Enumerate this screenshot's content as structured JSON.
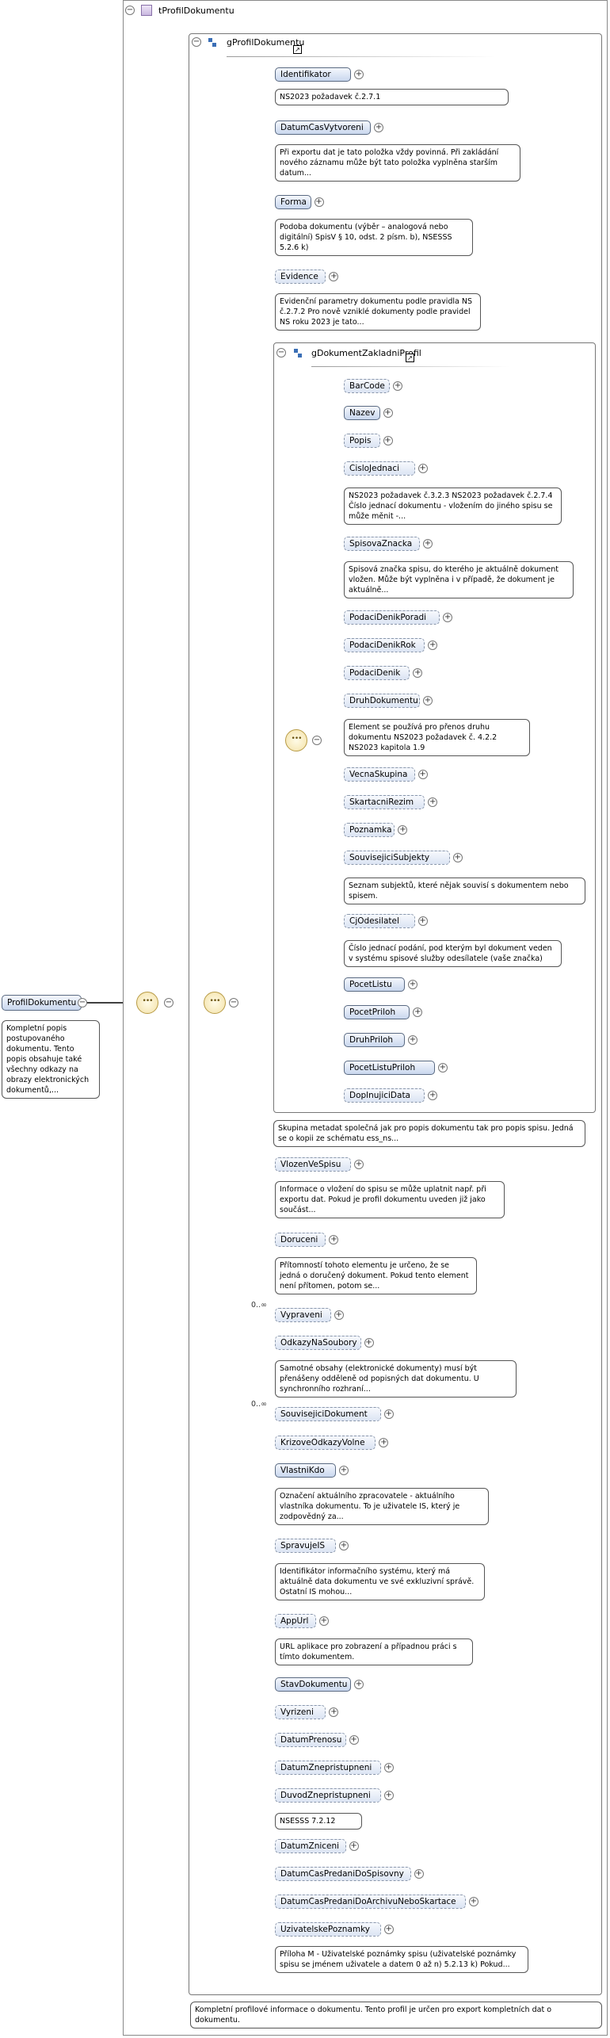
{
  "root": {
    "name": "ProfilDokumentu",
    "annotation": "Kompletní popis postupovaného dokumentu.  Tento popis obsahuje také všechny odkazy na obrazy elektronických dokumentů,..."
  },
  "complex_type": {
    "name": "tProfilDokumentu",
    "annotation": "Kompletní profilové informace o dokumentu. Tento profil je určen pro export kompletních dat o dokumentu."
  },
  "group_profil": {
    "name": "gProfilDokumentu",
    "annotation": "Skupina metadat společná jak pro popis dokumentu tak pro popis spisu. Jedná se o kopii ze schématu ess_ns..."
  },
  "group_zakladni": {
    "name": "gDokumentZakladniProfil"
  },
  "expand_symbol": "+",
  "collapse_symbol": "−",
  "sequence_glyph": "•••",
  "profil_elements": [
    {
      "name": "Identifikator",
      "annotation": "NS2023 požadavek č.2.7.1"
    },
    {
      "name": "DatumCasVytvoreni",
      "annotation": "Při exportu dat je tato položka vždy povinná. Při zakládání nového záznamu může být tato položka vyplněna starším datum..."
    },
    {
      "name": "Forma",
      "annotation": "Podoba dokumentu (výběr – analogová nebo digitální) SpisV § 10, odst. 2 písm. b), NSESSS 5.2.6 k)"
    },
    {
      "name": "Evidence",
      "annotation": "Evidenční parametry dokumentu podle pravidla NS č.2.7.2 Pro nově vzniklé dokumenty podle pravidel NS roku 2023 je tato..."
    },
    {
      "name": "VlozenVeSpisu",
      "annotation": "Informace o vložení do spisu se může uplatnit např. při exportu dat. Pokud je profil dokumentu uveden již jako součást..."
    },
    {
      "name": "Doruceni",
      "annotation": "Přítomností tohoto elementu je určeno, že se jedná o doručený dokument. Pokud tento element není přítomen, potom se..."
    },
    {
      "name": "Vypraveni",
      "occurs": "0..∞"
    },
    {
      "name": "OdkazyNaSoubory",
      "annotation": "Samotné obsahy (elektronické dokumenty) musí být přenášeny odděleně od popisných dat dokumentu. U synchronního rozhraní..."
    },
    {
      "name": "SouvisejiciDokument",
      "occurs": "0..∞"
    },
    {
      "name": "KrizoveOdkazyVolne"
    },
    {
      "name": "VlastniKdo",
      "annotation": "Označení aktuálního zpracovatele - aktuálního vlastníka dokumentu. To je uživatele IS, který je zodpovědný za..."
    },
    {
      "name": "SpravujeIS",
      "annotation": "Identifikátor informačního systému, který má aktuálně data dokumentu ve své exkluzivní správě. Ostatní IS mohou..."
    },
    {
      "name": "AppUrl",
      "annotation": "URL aplikace pro zobrazení a případnou práci s tímto dokumentem."
    },
    {
      "name": "StavDokumentu"
    },
    {
      "name": "Vyrizeni"
    },
    {
      "name": "DatumPrenosu"
    },
    {
      "name": "DatumZnepristupneni"
    },
    {
      "name": "DuvodZnepristupneni",
      "annotation": "NSESSS 7.2.12"
    },
    {
      "name": "DatumZniceni"
    },
    {
      "name": "DatumCasPredaniDoSpisovny"
    },
    {
      "name": "DatumCasPredaniDoArchivuNeboSkartace"
    },
    {
      "name": "UzivatelskePoznamky",
      "annotation": "Příloha M - Uživatelské poznámky spisu (uživatelské poznámky spisu se jménem uživatele a datem 0 až n) 5.2.13 k) Pokud..."
    }
  ],
  "zakladni_elements": [
    {
      "name": "BarCode"
    },
    {
      "name": "Nazev"
    },
    {
      "name": "Popis"
    },
    {
      "name": "CisloJednaci",
      "annotation": "NS2023 požadavek č.3.2.3 NS2023 požadavek č.2.7.4 Číslo jednací dokumentu - vložením do jiného spisu se může měnit -..."
    },
    {
      "name": "SpisovaZnacka",
      "annotation": "Spisová značka spisu, do kterého je aktuálně dokument vložen. Může být vyplněna i v případě, že dokument je aktuálně..."
    },
    {
      "name": "PodaciDenikPoradi"
    },
    {
      "name": "PodaciDenikRok"
    },
    {
      "name": "PodaciDenik"
    },
    {
      "name": "DruhDokumentu",
      "annotation": "Element se používá pro přenos druhu dokumentu NS2023 požadavek č. 4.2.2 NS2023 kapitola 1.9"
    },
    {
      "name": "VecnaSkupina"
    },
    {
      "name": "SkartacniRezim"
    },
    {
      "name": "Poznamka"
    },
    {
      "name": "SouvisejiciSubjekty",
      "annotation": "Seznam subjektů, které nějak souvisí s dokumentem nebo spisem."
    },
    {
      "name": "CjOdesilatel",
      "annotation": "Číslo jednací podání, pod kterým byl dokument veden v systému spisové služby odesílatele (vaše značka)"
    },
    {
      "name": "PocetListu"
    },
    {
      "name": "PocetPriloh"
    },
    {
      "name": "DruhPriloh"
    },
    {
      "name": "PocetListuPriloh"
    },
    {
      "name": "DoplnujiciData"
    }
  ]
}
